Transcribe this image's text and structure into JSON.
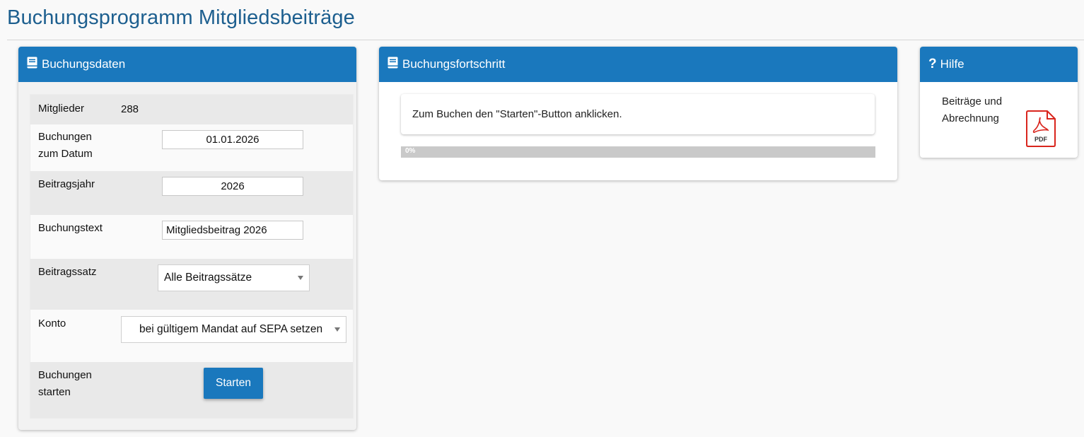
{
  "page": {
    "title": "Buchungsprogramm Mitgliedsbeiträge"
  },
  "booking_panel": {
    "title": "Buchungsdaten",
    "icon": "book-icon",
    "rows": {
      "members_label": "Mitglieder",
      "members_value": "288",
      "date_label_1": "Buchungen",
      "date_label_2": "zum Datum",
      "date_value": "01.01.2026",
      "year_label": "Beitragsjahr",
      "year_value": "2026",
      "text_label": "Buchungstext",
      "text_value": "Mitgliedsbeitrag 2026",
      "rate_label": "Beitragssatz",
      "rate_selected": "Alle Beitragssätze",
      "account_label": "Konto",
      "account_selected": "bei gültigem Mandat auf SEPA setzen",
      "start_label_1": "Buchungen",
      "start_label_2": "starten",
      "start_button": "Starten"
    }
  },
  "progress_panel": {
    "title": "Buchungsfortschritt",
    "icon": "book-icon",
    "message": "Zum Buchen den \"Starten\"-Button anklicken.",
    "progress_percent": 0,
    "progress_label": "0%"
  },
  "help_panel": {
    "title": "Hilfe",
    "icon": "question-icon",
    "link_line_1": "Beiträge und",
    "link_line_2": "Abrechnung",
    "pdf_icon_text": "PDF"
  },
  "colors": {
    "accent": "#1a78bd",
    "title": "#1d5f8f",
    "pdf_red": "#d9251d"
  }
}
